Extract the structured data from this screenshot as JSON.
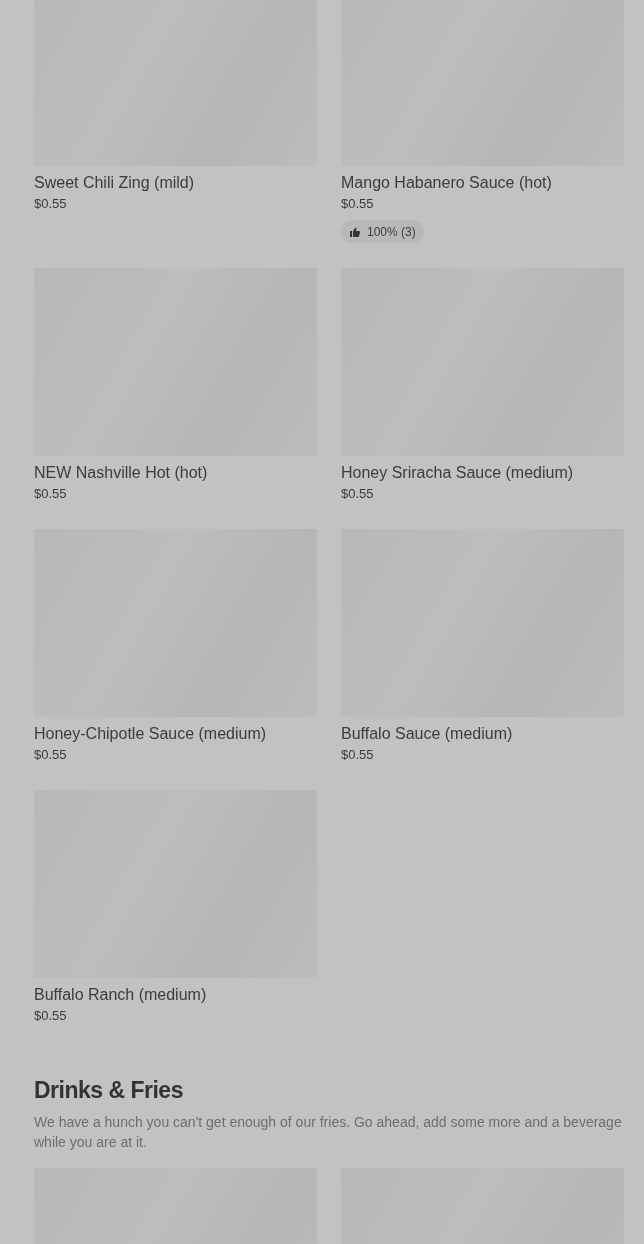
{
  "sections": [
    {
      "items": [
        {
          "kind": "product",
          "name": "Sweet Chili Zing (mild)",
          "price": "$0.55"
        },
        {
          "kind": "product",
          "name": "Mango Habanero Sauce (hot)",
          "price": "$0.55",
          "rating": "100% (3)"
        },
        {
          "kind": "product",
          "name": "NEW Nashville Hot (hot)",
          "price": "$0.55"
        },
        {
          "kind": "product",
          "name": "Honey Sriracha Sauce (medium)",
          "price": "$0.55"
        },
        {
          "kind": "product",
          "name": "Honey-Chipotle Sauce (medium)",
          "price": "$0.55"
        },
        {
          "kind": "product",
          "name": "Buffalo Sauce (medium)",
          "price": "$0.55"
        },
        {
          "kind": "product",
          "name": "Buffalo Ranch (medium)",
          "price": "$0.55"
        }
      ]
    },
    {
      "title": "Drinks & Fries",
      "description": "We have a hunch you can't get enough of our fries. Go ahead, add some more and a beverage while you are at it.",
      "items": [
        {
          "kind": "image-only"
        },
        {
          "kind": "image-only"
        }
      ]
    }
  ]
}
